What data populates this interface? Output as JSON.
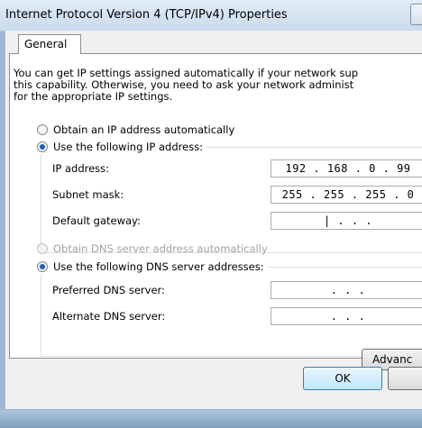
{
  "window": {
    "title": "Internet Protocol Version 4 (TCP/IPv4) Properties"
  },
  "tabs": [
    {
      "label": "General",
      "selected": true
    }
  ],
  "intro": {
    "line1": "You can get IP settings assigned automatically if your network sup",
    "line2": "this capability. Otherwise, you need to ask your network administ",
    "line3": "for the appropriate IP settings."
  },
  "ip_section": {
    "obtain_auto_label": "Obtain an IP address automatically",
    "use_following_label": "Use the following IP address:",
    "fields": [
      {
        "label": "IP address:",
        "value": "192 . 168 .  0  . 99"
      },
      {
        "label": "Subnet mask:",
        "value": "255 . 255 . 255 .  0"
      },
      {
        "label": "Default gateway:",
        "value": "|    .      .      ."
      }
    ]
  },
  "dns_section": {
    "obtain_auto_label": "Obtain DNS server address automatically",
    "use_following_label": "Use the following DNS server addresses:",
    "fields": [
      {
        "label": "Preferred DNS server:",
        "value": ".      .      ."
      },
      {
        "label": "Alternate DNS server:",
        "value": ".      .      ."
      }
    ]
  },
  "buttons": {
    "advanced": "Advanc",
    "ok": "OK"
  }
}
